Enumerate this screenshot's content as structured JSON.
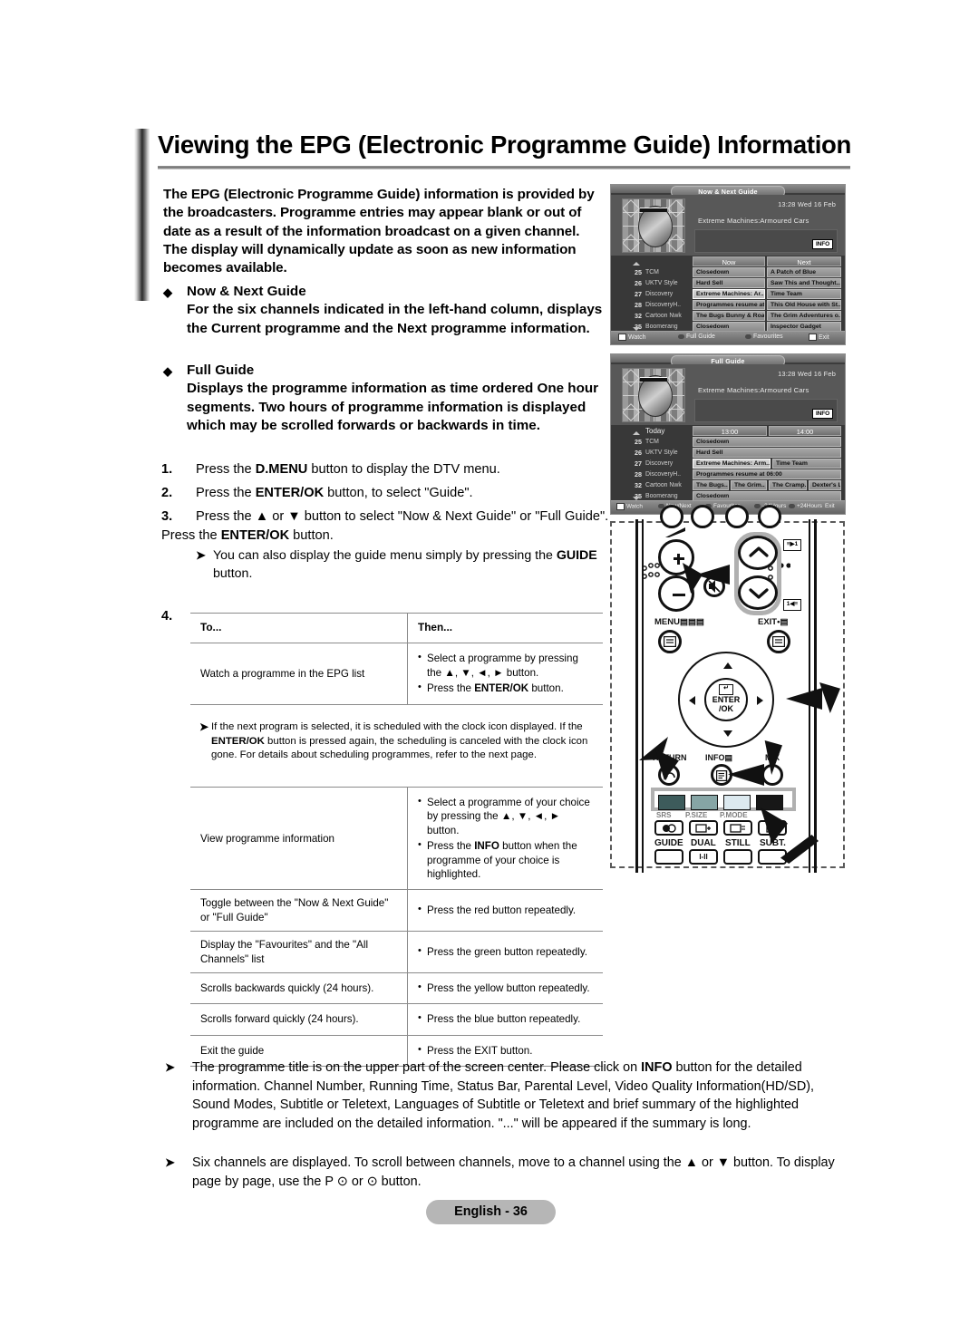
{
  "page": {
    "title": "Viewing the EPG (Electronic Programme Guide) Information",
    "footer_badge": "English - 36"
  },
  "intro": {
    "paragraph": "The EPG (Electronic Programme Guide) information is provided by the broadcasters. Programme entries may appear blank or out of date as a result of the information broadcast on a given channel. The display will dynamically update as soon as new information becomes available."
  },
  "bullets": [
    {
      "heading": "Now & Next Guide",
      "body": "For the six channels indicated in the left-hand column, displays the Current programme and the Next programme information."
    },
    {
      "heading": "Full Guide",
      "body": "Displays the programme information as time ordered One hour segments. Two hours of programme information is displayed which may be scrolled forwards or backwards in time."
    }
  ],
  "steps": [
    {
      "num": "1.",
      "pre": "Press the ",
      "bold": "D.MENU",
      "post": " button to display the DTV menu."
    },
    {
      "num": "2.",
      "pre": "Press the ",
      "bold": "ENTER/OK",
      "post": " button, to select \"Guide\"."
    },
    {
      "num": "3.",
      "line1": "Press the ▲ or ▼ button to select \"Now & Next Guide\" or \"Full Guide\".",
      "line2_pre": "Press the ",
      "line2_bold": "ENTER/OK",
      "line2_post": " button.",
      "sub_pre": "You can also display the guide menu simply by pressing the ",
      "sub_bold": "GUIDE",
      "sub_post": " button."
    },
    {
      "num": "4."
    }
  ],
  "table": {
    "headers": {
      "to": "To...",
      "then": "Then..."
    },
    "rows_top": [
      {
        "to": "Watch a programme in the EPG list",
        "then": [
          {
            "pre": "Select a programme by pressing the ▲, ▼, ◄, ► button.",
            "bold": "",
            "post": ""
          },
          {
            "pre": "Press the ",
            "bold": "ENTER/OK",
            "post": " button."
          }
        ]
      }
    ],
    "note": {
      "pre": "If the next program is selected, it is scheduled with the clock icon displayed. If the ",
      "bold": "ENTER/OK",
      "post": " button is pressed again, the scheduling is canceled with the clock icon gone. For details about scheduling programmes, refer to the next page."
    },
    "rows_bottom": [
      {
        "to": "View programme information",
        "then": [
          {
            "pre": "Select a programme of your choice by pressing the ▲, ▼, ◄, ► button.",
            "bold": "",
            "post": ""
          },
          {
            "pre": "Press the ",
            "bold": "INFO",
            "post": " button when the programme of your choice is highlighted."
          }
        ]
      },
      {
        "to": "Toggle between the \"Now & Next Guide\" or \"Full Guide\"",
        "then": [
          {
            "pre": "Press the red button repeatedly.",
            "bold": "",
            "post": ""
          }
        ]
      },
      {
        "to": "Display the \"Favourites\" and the \"All Channels\" list",
        "then": [
          {
            "pre": "Press the green button repeatedly.",
            "bold": "",
            "post": ""
          }
        ]
      },
      {
        "to": "Scrolls backwards quickly (24 hours).",
        "then": [
          {
            "pre": "Press the yellow button repeatedly.",
            "bold": "",
            "post": ""
          }
        ]
      },
      {
        "to": "Scrolls forward quickly (24 hours).",
        "then": [
          {
            "pre": "Press the blue button repeatedly.",
            "bold": "",
            "post": ""
          }
        ]
      },
      {
        "to": "Exit the guide",
        "then": [
          {
            "pre": "Press the EXIT button.",
            "bold": "",
            "post": ""
          }
        ]
      }
    ]
  },
  "notes": [
    {
      "pre": "The programme title is on the upper part of the screen center. Please click on ",
      "bold": "INFO",
      "post": " button for the detailed information. Channel Number, Running Time, Status Bar, Parental Level, Video Quality Information(HD/SD), Sound Modes, Subtitle or Teletext, Languages of Subtitle or Teletext and brief summary of the highlighted programme are included on the detailed information. \"...\" will be appeared if the summary is long."
    },
    {
      "pre": "Six channels are displayed. To scroll between channels, move to a channel using the ▲ or ▼ button. To display page by page, use the P ⊙ or ⊙ button.",
      "bold": "",
      "post": ""
    }
  ],
  "tv_screens": [
    {
      "id": "now-next-guide",
      "title": "Now & Next Guide",
      "time": "13:28 Wed 16 Feb",
      "programme_title": "Extreme Machines:Armoured Cars",
      "info_button": "INFO",
      "col_headers": [
        "Now",
        "Next"
      ],
      "rows": [
        {
          "num": "25",
          "name": "TCM",
          "now": "Closedown",
          "next": "A Patch of Blue",
          "selected": false
        },
        {
          "num": "26",
          "name": "UKTV Style",
          "now": "Hard Sell",
          "next": "Saw This and Thought...",
          "selected": false
        },
        {
          "num": "27",
          "name": "Discovery",
          "now": "Extreme Machines: Ar..",
          "next": "Time Team",
          "selected": true
        },
        {
          "num": "28",
          "name": "DiscoveryH..",
          "now": "Programmes resume at..",
          "next": "This Old House with St...",
          "selected": false
        },
        {
          "num": "32",
          "name": "Cartoon Nwk",
          "now": "The Bugs Bunny & Roa..",
          "next": "The Grim Adventures o..",
          "selected": false
        },
        {
          "num": "35",
          "name": "Boomerang",
          "now": "Closedown",
          "next": "Inspector Gadget",
          "selected": false
        }
      ],
      "bottom_bar": [
        "Watch",
        "Full Guide",
        "Favourites",
        "Exit"
      ]
    },
    {
      "id": "full-guide",
      "title": "Full Guide",
      "time": "13:28 Wed 16 Feb",
      "programme_title": "Extreme Machines:Armoured Cars",
      "info_button": "INFO",
      "col_headers": [
        "Today",
        "13:00",
        "14:00"
      ],
      "rows": [
        {
          "num": "25",
          "name": "TCM",
          "progs": [
            "Closedown"
          ],
          "selected_index": -1
        },
        {
          "num": "26",
          "name": "UKTV Style",
          "progs": [
            "Hard Sell"
          ],
          "selected_index": -1
        },
        {
          "num": "27",
          "name": "Discovery",
          "progs": [
            "Extreme Machines: Arm..",
            "Time Team"
          ],
          "selected_index": 0
        },
        {
          "num": "28",
          "name": "DiscoveryH..",
          "progs": [
            "Programmes resume at 06:00"
          ],
          "selected_index": -1
        },
        {
          "num": "32",
          "name": "Cartoon Nwk",
          "progs": [
            "The Bugs..",
            "The Grim..",
            "The Cramp..",
            "Dexter's L.."
          ],
          "selected_index": -1
        },
        {
          "num": "35",
          "name": "Boomerang",
          "progs": [
            "Closedown"
          ],
          "selected_index": -1
        }
      ],
      "bottom_bar": [
        "Watch",
        "Now/Next",
        "Favourites",
        "-24Hours",
        "+24Hours",
        "Exit"
      ]
    }
  ],
  "remote": {
    "labels": {
      "menu": "MENU",
      "exit": "EXIT",
      "enter": "ENTER",
      "enter2": "/OK",
      "return": "RETURN",
      "info": "INFO",
      "mix": "MIX",
      "srs": "SRS",
      "pmode": "P.MODE",
      "psize": "P.SIZE",
      "guide": "GUIDE",
      "dual": "DUAL",
      "still": "STILL",
      "subt": "SUBT.",
      "dual_sub": "I-II"
    },
    "color_buttons": [
      "red",
      "green",
      "yellow",
      "blue"
    ],
    "color_hex": [
      "#3d5b5b",
      "#86a5a5",
      "#dce9ef",
      "#171717"
    ]
  }
}
